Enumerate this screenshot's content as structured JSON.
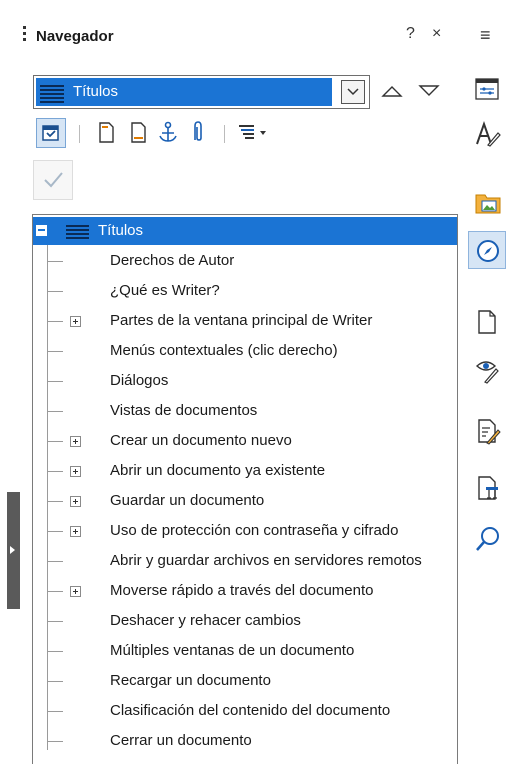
{
  "panel": {
    "title": "Navegador",
    "help_label": "?",
    "close_label": "×",
    "menu_label": "≡"
  },
  "category_select": {
    "selected": "Títulos",
    "icon": "headings-icon"
  },
  "nav_arrows": {
    "previous": "△",
    "next": "▽"
  },
  "toolbar": {
    "items": [
      "content-navigation-view-icon",
      "header-icon",
      "footer-icon",
      "anchor-icon",
      "reminder-icon",
      "heading-levels-icon"
    ]
  },
  "tree": {
    "root": "Títulos",
    "items": [
      {
        "label": "Derechos de Autor",
        "expandable": false
      },
      {
        "label": "¿Qué es Writer?",
        "expandable": false
      },
      {
        "label": "Partes de la ventana principal de Writer",
        "expandable": true
      },
      {
        "label": "Menús contextuales (clic derecho)",
        "expandable": false
      },
      {
        "label": "Diálogos",
        "expandable": false
      },
      {
        "label": "Vistas de documentos",
        "expandable": false
      },
      {
        "label": "Crear un documento nuevo",
        "expandable": true
      },
      {
        "label": "Abrir un documento ya existente",
        "expandable": true
      },
      {
        "label": "Guardar un documento",
        "expandable": true
      },
      {
        "label": "Uso de protección con contraseña y cifrado",
        "expandable": true
      },
      {
        "label": "Abrir y guardar archivos en servidores remotos",
        "expandable": false
      },
      {
        "label": "Moverse rápido a través del documento",
        "expandable": true
      },
      {
        "label": "Deshacer y rehacer cambios",
        "expandable": false
      },
      {
        "label": "Múltiples ventanas de un documento",
        "expandable": false
      },
      {
        "label": "Recargar un documento",
        "expandable": false
      },
      {
        "label": "Clasificación del contenido del documento",
        "expandable": false
      },
      {
        "label": "Cerrar un documento",
        "expandable": false
      }
    ]
  },
  "sidebar": {
    "items": [
      "properties-icon",
      "styles-icon",
      "gallery-icon",
      "navigator-icon",
      "page-icon",
      "style-inspector-icon",
      "manage-changes-icon",
      "design-icon",
      "find-icon"
    ],
    "active": "navigator-icon"
  },
  "colors": {
    "selection": "#1b74d4",
    "accent": "#1b74d4"
  }
}
